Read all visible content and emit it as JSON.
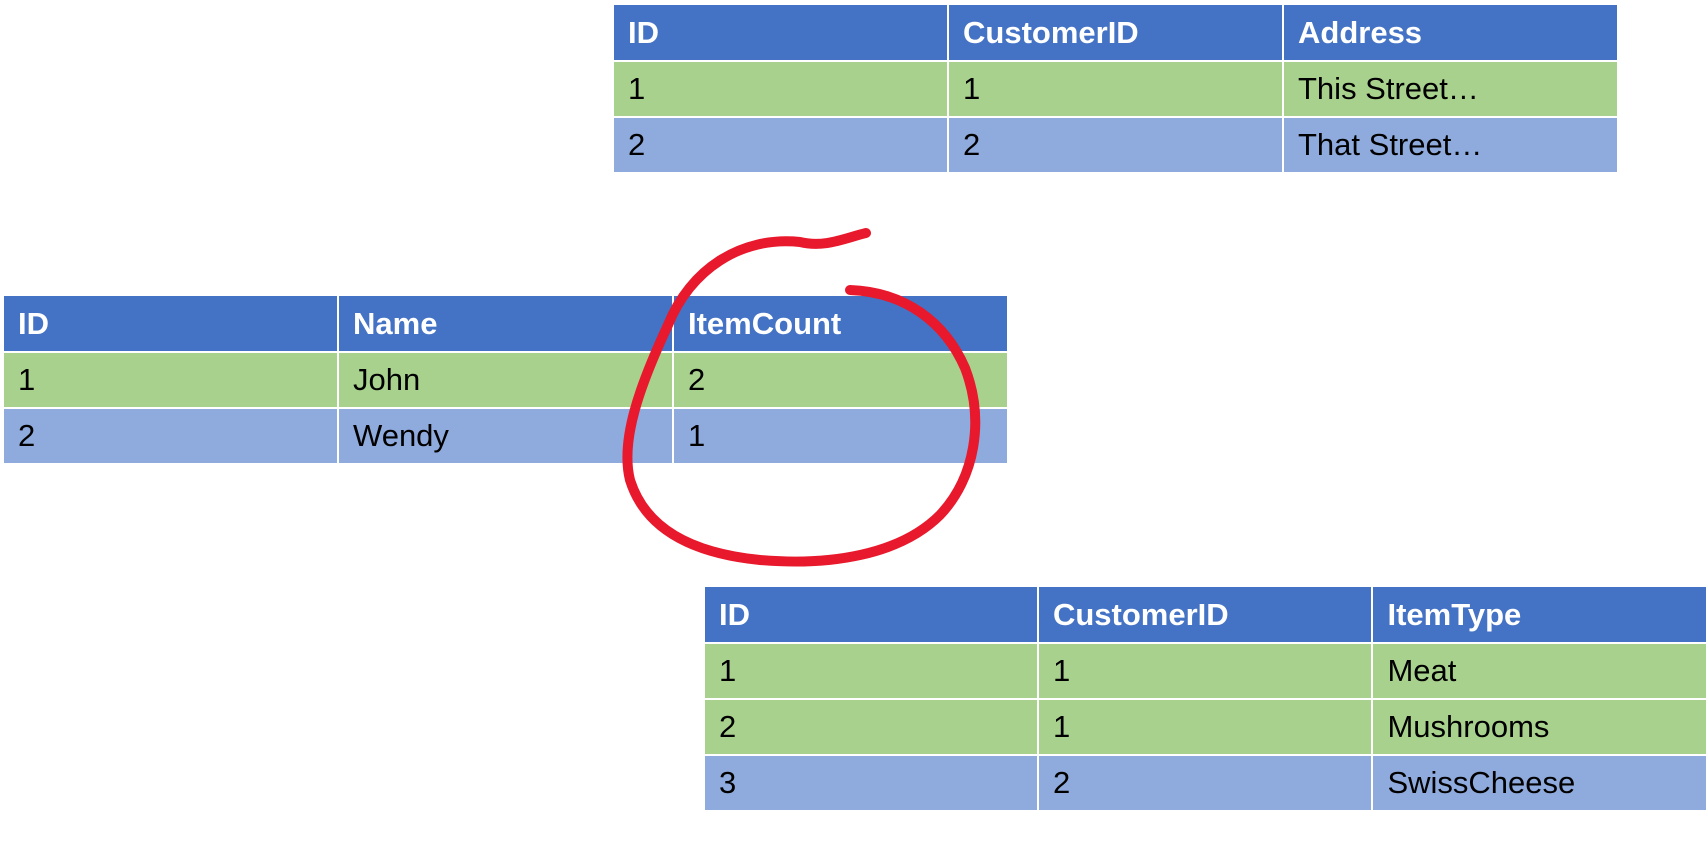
{
  "address_table": {
    "headers": [
      "ID",
      "CustomerID",
      "Address"
    ],
    "rows": [
      {
        "color": "green",
        "cells": [
          "1",
          "1",
          "This Street…"
        ]
      },
      {
        "color": "blue",
        "cells": [
          "2",
          "2",
          "That Street…"
        ]
      }
    ]
  },
  "customer_table": {
    "headers": [
      "ID",
      "Name",
      "ItemCount"
    ],
    "rows": [
      {
        "color": "green",
        "cells": [
          "1",
          "John",
          "2"
        ]
      },
      {
        "color": "blue",
        "cells": [
          "2",
          "Wendy",
          "1"
        ]
      }
    ]
  },
  "item_table": {
    "headers": [
      "ID",
      "CustomerID",
      "ItemType"
    ],
    "rows": [
      {
        "color": "green",
        "cells": [
          "1",
          "1",
          "Meat"
        ]
      },
      {
        "color": "green",
        "cells": [
          "2",
          "1",
          "Mushrooms"
        ]
      },
      {
        "color": "blue",
        "cells": [
          "3",
          "2",
          "SwissCheese"
        ]
      }
    ]
  },
  "colors": {
    "header": "#4472c4",
    "row_green": "#a9d18e",
    "row_blue": "#8faadc",
    "annotation": "#e8192c"
  },
  "annotation": {
    "shape": "hand-drawn-circle",
    "target": "customer_table.ItemCount"
  }
}
